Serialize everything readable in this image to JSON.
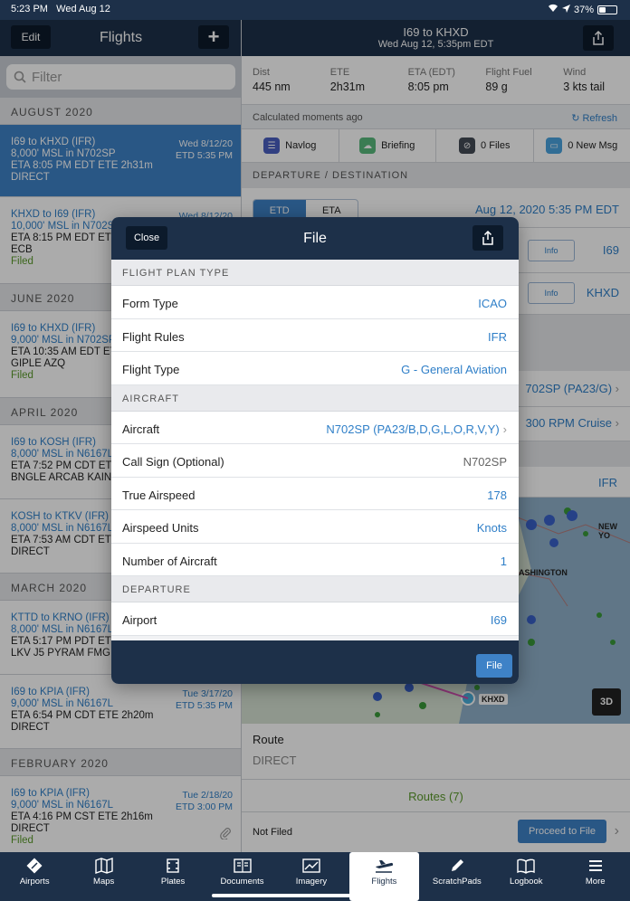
{
  "status_bar": {
    "time": "5:23 PM",
    "date": "Wed Aug 12",
    "battery": "37%"
  },
  "left_panel": {
    "edit_label": "Edit",
    "title": "Flights",
    "filter_placeholder": "Filter",
    "sections": [
      {
        "label": "AUGUST 2020",
        "items": [
          {
            "line1": "I69 to KHXD (IFR)",
            "line2": "8,000' MSL in N702SP",
            "line3": "ETA 8:05 PM EDT ETE 2h31m",
            "line4": "DIRECT",
            "status": "",
            "date": "Wed 8/12/20",
            "etd": "ETD 5:35 PM",
            "selected": true
          },
          {
            "line1": "KHXD to I69 (IFR)",
            "line2": "10,000' MSL in N702SP",
            "line3": "ETA 8:15 PM EDT ETE",
            "line4": "ECB",
            "status": "Filed",
            "date": "Wed 8/12/20",
            "etd": "",
            "selected": false
          }
        ]
      },
      {
        "label": "JUNE 2020",
        "items": [
          {
            "line1": "I69 to KHXD (IFR)",
            "line2": "9,000' MSL in N702SP",
            "line3": "ETA 10:35 AM EDT ETE",
            "line4": "GIPLE AZQ",
            "status": "Filed",
            "date": "",
            "etd": "",
            "selected": false
          }
        ]
      },
      {
        "label": "APRIL 2020",
        "items": [
          {
            "line1": "I69 to KOSH (IFR)",
            "line2": "8,000' MSL in N6167L",
            "line3": "ETA 7:52 PM CDT ETE",
            "line4": "BNGLE ARCAB KAIN",
            "status": "",
            "date": "",
            "etd": "",
            "selected": false
          },
          {
            "line1": "KOSH to KTKV (IFR)",
            "line2": "8,000' MSL in N6167L",
            "line3": "ETA 7:53 AM CDT ETE",
            "line4": "DIRECT",
            "status": "",
            "date": "",
            "etd": "",
            "selected": false
          }
        ]
      },
      {
        "label": "MARCH 2020",
        "items": [
          {
            "line1": "KTTD to KRNO (IFR)",
            "line2": "8,000' MSL in N6167L",
            "line3": "ETA 5:17 PM PDT ETE",
            "line4": "LKV J5 PYRAM FMG",
            "status": "",
            "date": "",
            "etd": "",
            "selected": false
          },
          {
            "line1": "I69 to KPIA (IFR)",
            "line2": "9,000' MSL in N6167L",
            "line3": "ETA 6:54 PM CDT ETE 2h20m",
            "line4": "DIRECT",
            "status": "",
            "date": "Tue 3/17/20",
            "etd": "ETD 5:35 PM",
            "selected": false
          }
        ]
      },
      {
        "label": "FEBRUARY 2020",
        "items": [
          {
            "line1": "I69 to KPIA (IFR)",
            "line2": "9,000' MSL in N6167L",
            "line3": "ETA 4:16 PM CST ETE 2h16m",
            "line4": "DIRECT",
            "status": "Filed",
            "date": "Tue 2/18/20",
            "etd": "ETD 3:00 PM",
            "selected": false
          }
        ]
      }
    ]
  },
  "right_panel": {
    "title": "I69 to KHXD",
    "subtitle": "Wed Aug 12, 5:35pm EDT",
    "stats": [
      {
        "label": "Dist",
        "value": "445 nm"
      },
      {
        "label": "ETE",
        "value": "2h31m"
      },
      {
        "label": "ETA (EDT)",
        "value": "8:05 pm"
      },
      {
        "label": "Flight Fuel",
        "value": "89 g"
      },
      {
        "label": "Wind",
        "value": "3 kts tail"
      }
    ],
    "calc_text": "Calculated moments ago",
    "refresh_label": "Refresh",
    "tools": [
      {
        "label": "Navlog",
        "icon": "list-icon",
        "color": "#4a5fc1"
      },
      {
        "label": "Briefing",
        "icon": "cloud-icon",
        "color": "#59b97c"
      },
      {
        "label": "0 Files",
        "icon": "paperclip-icon",
        "color": "#444b55"
      },
      {
        "label": "0 New Msg",
        "icon": "message-icon",
        "color": "#4aa3df"
      }
    ],
    "dep_dest_label": "DEPARTURE / DESTINATION",
    "etd_label": "ETD",
    "eta_label": "ETA",
    "departure_time": "Aug 12, 2020 5:35 PM EDT",
    "info_label": "Info",
    "departure_airport": "I69",
    "destination_airport": "KHXD",
    "aircraft_partial": "702SP (PA23/G)",
    "cruise_partial": "300 RPM Cruise",
    "rules_partial": "IFR",
    "map_labels": {
      "new_york": "NEW YO",
      "washington": "ASHINGTON",
      "khxd": "KHXD",
      "btn_3d": "3D"
    },
    "route_label": "Route",
    "route_value": "DIRECT",
    "routes_count": "Routes (7)",
    "not_filed": "Not Filed",
    "proceed_label": "Proceed to File"
  },
  "modal": {
    "close_label": "Close",
    "title": "File",
    "sections": {
      "flight_plan_type": "FLIGHT PLAN TYPE",
      "aircraft": "AIRCRAFT",
      "departure": "DEPARTURE"
    },
    "rows": {
      "form_type": {
        "label": "Form Type",
        "value": "ICAO"
      },
      "flight_rules": {
        "label": "Flight Rules",
        "value": "IFR"
      },
      "flight_type": {
        "label": "Flight Type",
        "value": "G - General Aviation"
      },
      "aircraft": {
        "label": "Aircraft",
        "value": "N702SP (PA23/B,D,G,L,O,R,V,Y)"
      },
      "call_sign": {
        "label": "Call Sign (Optional)",
        "value": "N702SP"
      },
      "true_airspeed": {
        "label": "True Airspeed",
        "value": "178"
      },
      "airspeed_units": {
        "label": "Airspeed Units",
        "value": "Knots"
      },
      "num_aircraft": {
        "label": "Number of Aircraft",
        "value": "1"
      },
      "airport": {
        "label": "Airport",
        "value": "I69"
      }
    },
    "file_label": "File"
  },
  "tab_bar": [
    {
      "label": "Airports",
      "icon": "airports-icon"
    },
    {
      "label": "Maps",
      "icon": "maps-icon"
    },
    {
      "label": "Plates",
      "icon": "plates-icon"
    },
    {
      "label": "Documents",
      "icon": "documents-icon"
    },
    {
      "label": "Imagery",
      "icon": "imagery-icon"
    },
    {
      "label": "Flights",
      "icon": "flights-icon",
      "active": true
    },
    {
      "label": "ScratchPads",
      "icon": "scratchpads-icon"
    },
    {
      "label": "Logbook",
      "icon": "logbook-icon"
    },
    {
      "label": "More",
      "icon": "more-icon"
    }
  ]
}
